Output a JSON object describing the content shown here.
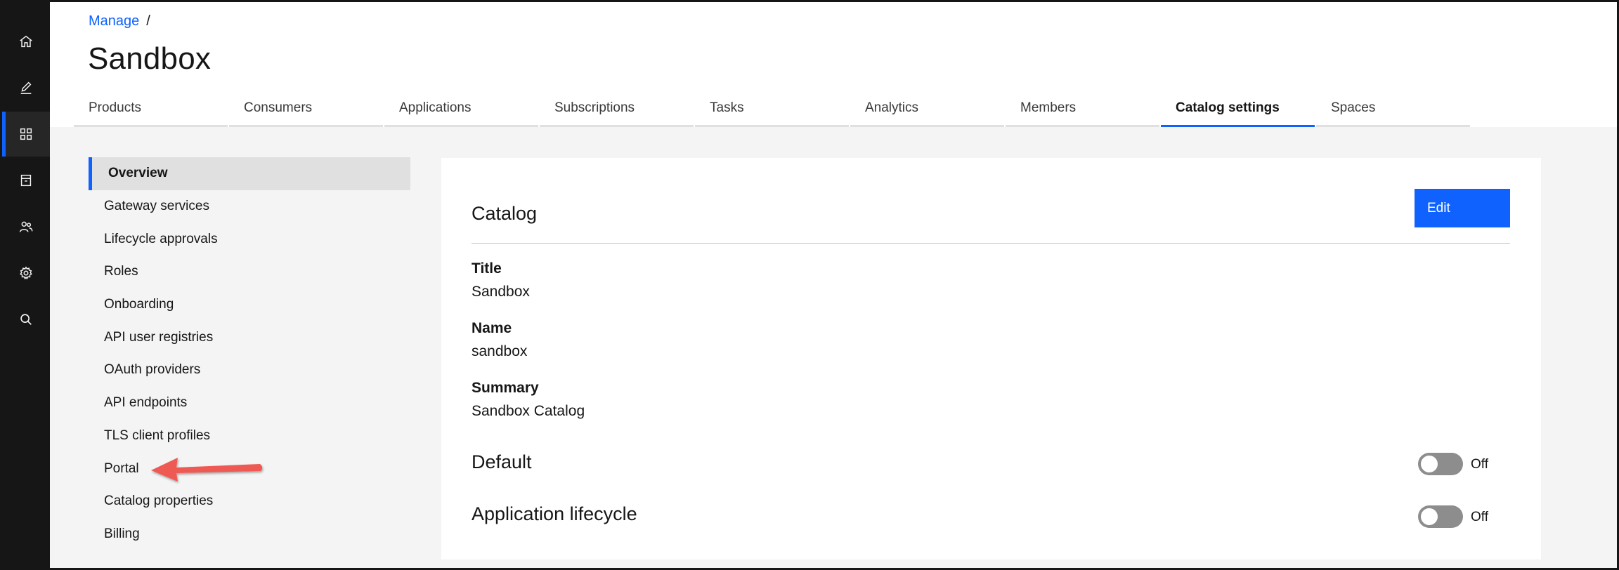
{
  "breadcrumb": {
    "link": "Manage",
    "separator": "/"
  },
  "page_title": "Sandbox",
  "rail": [
    {
      "icon": "home-icon"
    },
    {
      "icon": "edit-icon"
    },
    {
      "icon": "grid-icon",
      "active": true
    },
    {
      "icon": "archive-icon"
    },
    {
      "icon": "users-icon"
    },
    {
      "icon": "gear-icon"
    },
    {
      "icon": "search-icon"
    }
  ],
  "tabs": [
    {
      "label": "Products"
    },
    {
      "label": "Consumers"
    },
    {
      "label": "Applications"
    },
    {
      "label": "Subscriptions"
    },
    {
      "label": "Tasks"
    },
    {
      "label": "Analytics"
    },
    {
      "label": "Members"
    },
    {
      "label": "Catalog settings",
      "active": true
    },
    {
      "label": "Spaces"
    }
  ],
  "subnav": [
    {
      "label": "Overview",
      "active": true
    },
    {
      "label": "Gateway services"
    },
    {
      "label": "Lifecycle approvals"
    },
    {
      "label": "Roles"
    },
    {
      "label": "Onboarding"
    },
    {
      "label": "API user registries"
    },
    {
      "label": "OAuth providers"
    },
    {
      "label": "API endpoints"
    },
    {
      "label": "TLS client profiles"
    },
    {
      "label": "Portal"
    },
    {
      "label": "Catalog properties"
    },
    {
      "label": "Billing"
    }
  ],
  "card": {
    "heading": "Catalog",
    "edit_label": "Edit",
    "fields": [
      {
        "label": "Title",
        "value": "Sandbox"
      },
      {
        "label": "Name",
        "value": "sandbox"
      },
      {
        "label": "Summary",
        "value": "Sandbox Catalog"
      }
    ],
    "toggles": [
      {
        "label": "Default",
        "state": "Off"
      },
      {
        "label": "Application lifecycle",
        "state": "Off"
      }
    ]
  },
  "colors": {
    "accent": "#0f62fe",
    "rail_bg": "#161616",
    "content_bg": "#f4f4f4",
    "annotation_arrow": "#ee5a52"
  },
  "annotation": {
    "target": "Portal",
    "icon": "arrow-left-icon"
  }
}
